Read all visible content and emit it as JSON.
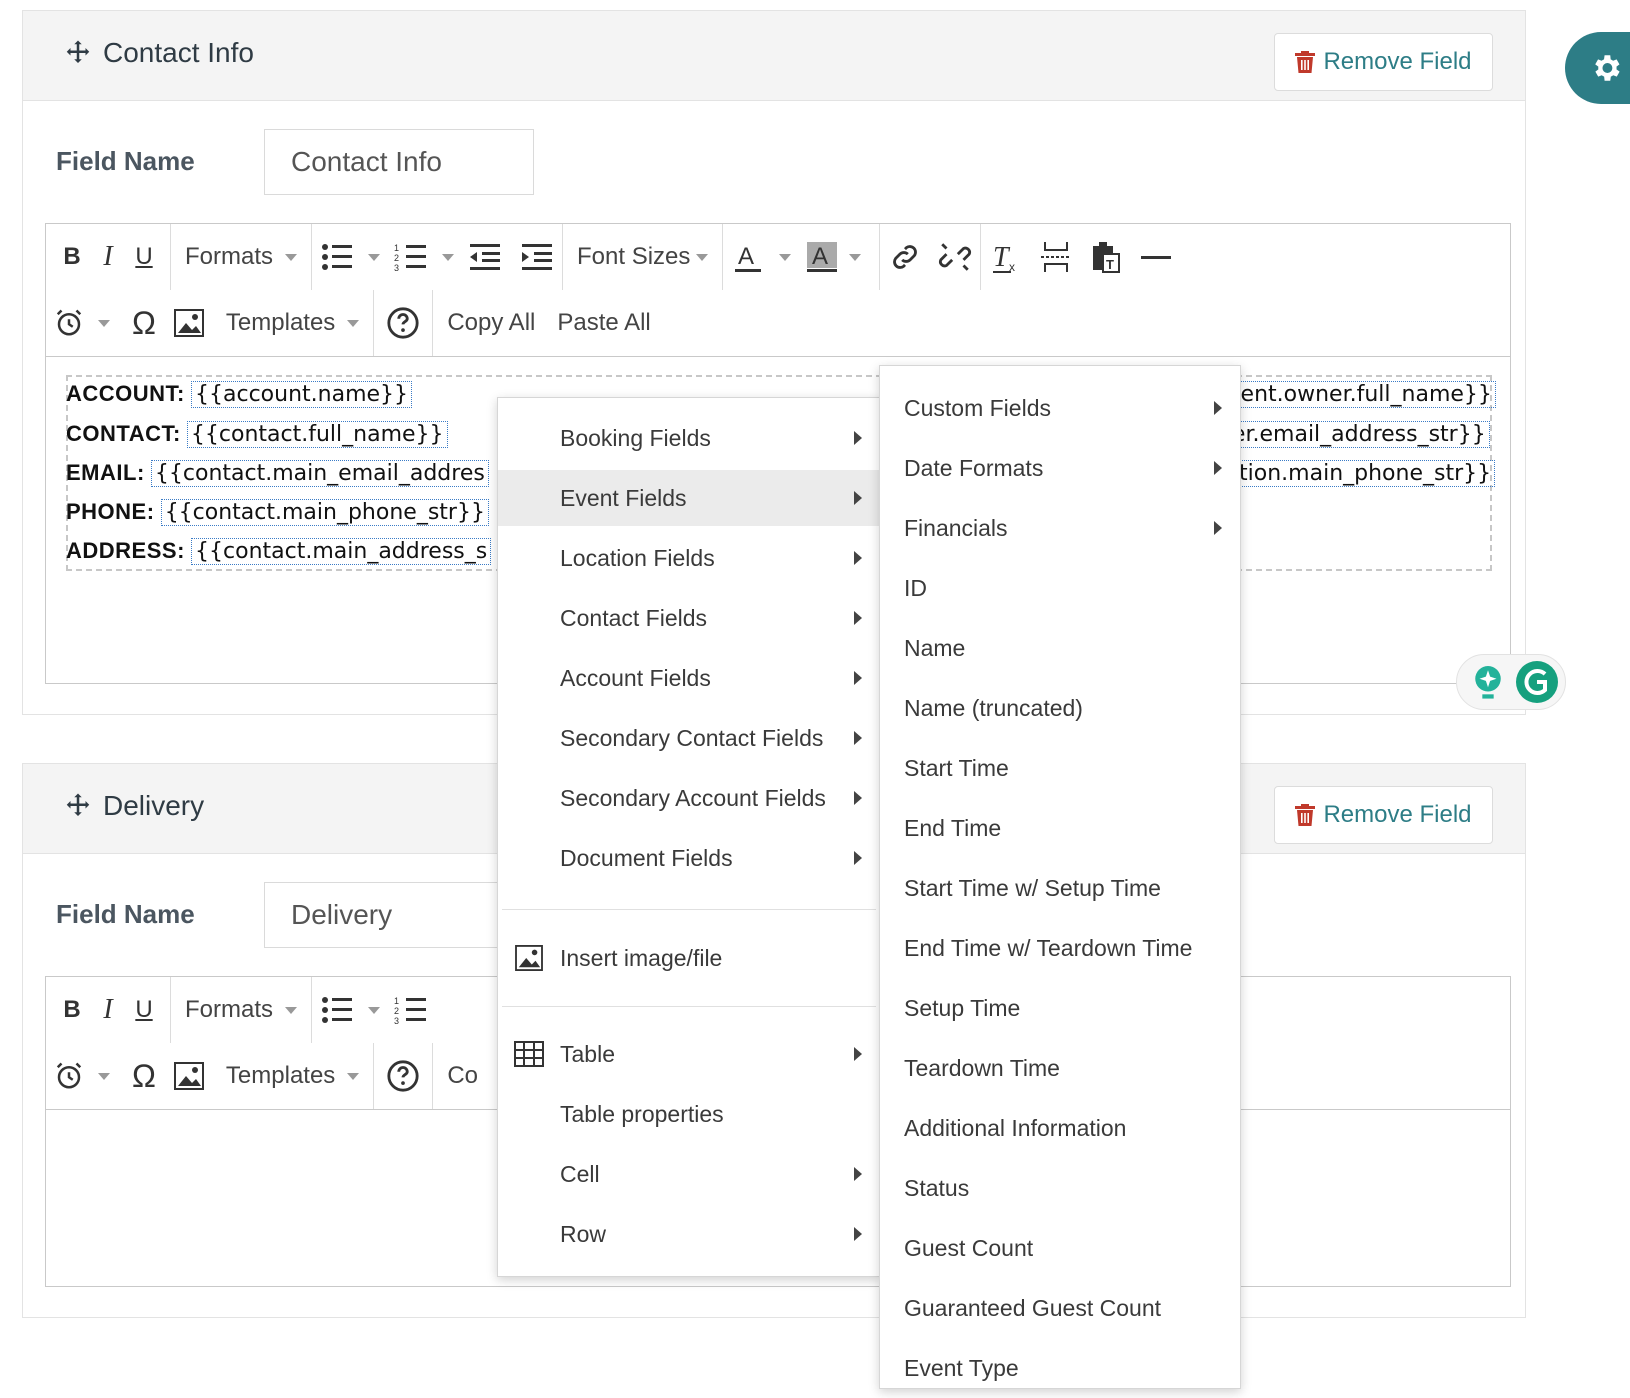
{
  "panel1": {
    "title": "Contact Info",
    "remove_label": "Remove Field",
    "field_name_label": "Field Name",
    "field_name_value": "Contact Info"
  },
  "panel2": {
    "title": "Delivery",
    "remove_label": "Remove Field",
    "field_name_label": "Field Name",
    "field_name_value": "Delivery"
  },
  "toolbar": {
    "formats": "Formats",
    "font_sizes": "Font Sizes",
    "templates": "Templates",
    "copy_all": "Copy All",
    "paste_all": "Paste All",
    "copy_all_truncated": "Co",
    "bold": "B",
    "italic": "I",
    "underline": "U"
  },
  "document": {
    "rows": [
      {
        "label": "ACCOUNT:",
        "tag": "{{account.name}}"
      },
      {
        "label": "CONTACT:",
        "tag": "{{contact.full_name}}"
      },
      {
        "label": "EMAIL:",
        "tag": "{{contact.main_email_addres"
      },
      {
        "label": "PHONE:",
        "tag": "{{contact.main_phone_str}}"
      },
      {
        "label": "ADDRESS:",
        "tag": "{{contact.main_address_s"
      }
    ],
    "right_tags": [
      "{event.owner.full_name}}",
      "wner.email_address_str}}",
      "ocation.main_phone_str}}"
    ]
  },
  "context_menu": {
    "items": [
      {
        "label": "Booking Fields",
        "submenu": true
      },
      {
        "label": "Event Fields",
        "submenu": true,
        "active": true
      },
      {
        "label": "Location Fields",
        "submenu": true
      },
      {
        "label": "Contact Fields",
        "submenu": true
      },
      {
        "label": "Account Fields",
        "submenu": true
      },
      {
        "label": "Secondary Contact Fields",
        "submenu": true
      },
      {
        "label": "Secondary Account Fields",
        "submenu": true
      },
      {
        "label": "Document Fields",
        "submenu": true
      }
    ],
    "insert_image": "Insert image/file",
    "table_items": [
      {
        "label": "Table",
        "submenu": true
      },
      {
        "label": "Table properties",
        "submenu": false
      },
      {
        "label": "Cell",
        "submenu": true
      },
      {
        "label": "Row",
        "submenu": true
      }
    ]
  },
  "event_submenu": {
    "items": [
      {
        "label": "Custom Fields",
        "submenu": true
      },
      {
        "label": "Date Formats",
        "submenu": true
      },
      {
        "label": "Financials",
        "submenu": true
      },
      {
        "label": "ID",
        "submenu": false
      },
      {
        "label": "Name",
        "submenu": false
      },
      {
        "label": "Name (truncated)",
        "submenu": false
      },
      {
        "label": "Start Time",
        "submenu": false
      },
      {
        "label": "End Time",
        "submenu": false
      },
      {
        "label": "Start Time w/ Setup Time",
        "submenu": false
      },
      {
        "label": "End Time w/ Teardown Time",
        "submenu": false
      },
      {
        "label": "Setup Time",
        "submenu": false
      },
      {
        "label": "Teardown Time",
        "submenu": false
      },
      {
        "label": "Additional Information",
        "submenu": false
      },
      {
        "label": "Status",
        "submenu": false
      },
      {
        "label": "Guest Count",
        "submenu": false
      },
      {
        "label": "Guaranteed Guest Count",
        "submenu": false
      },
      {
        "label": "Event Type",
        "submenu": false
      }
    ]
  },
  "colors": {
    "accent": "#2d7d86",
    "trash": "#c0392b"
  }
}
